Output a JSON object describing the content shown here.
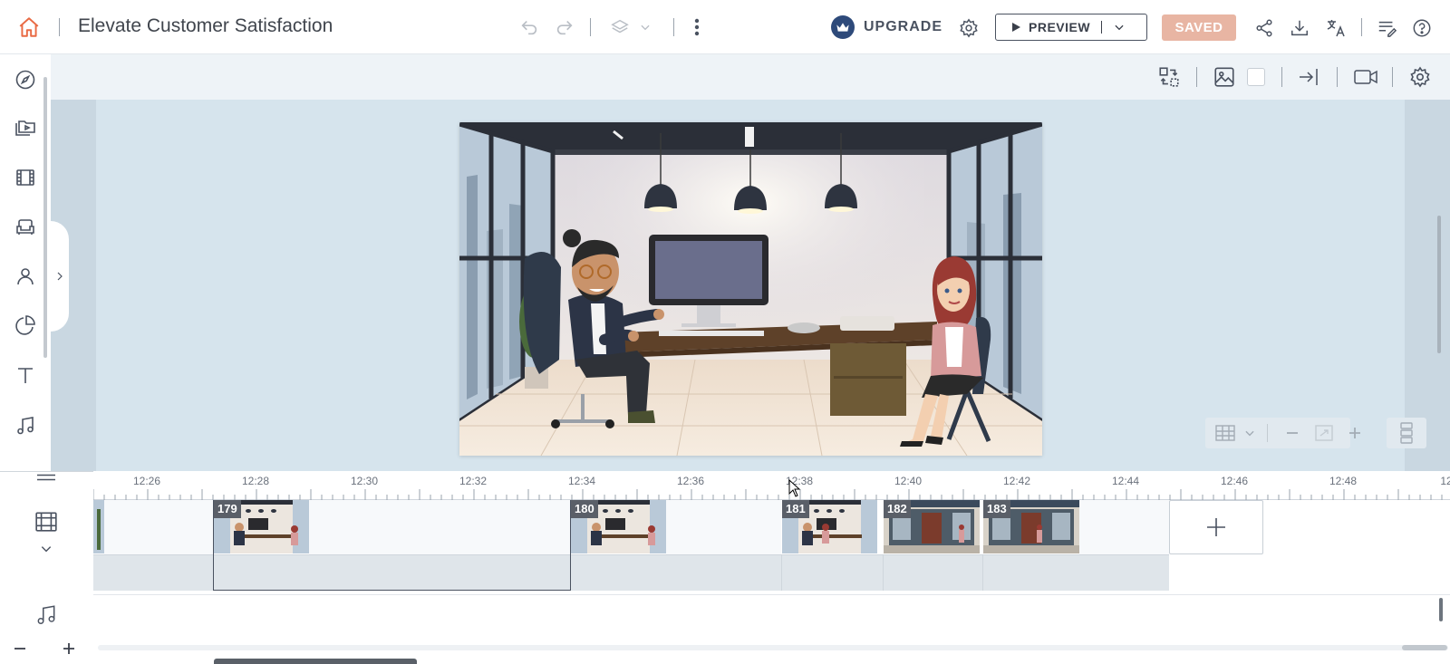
{
  "header": {
    "title": "Elevate Customer Satisfaction",
    "upgrade_label": "UPGRADE",
    "preview_label": "PREVIEW",
    "saved_label": "SAVED"
  },
  "sidebar": {
    "items": [
      {
        "name": "explore",
        "icon": "compass-icon"
      },
      {
        "name": "media",
        "icon": "video-folder-icon"
      },
      {
        "name": "scenes",
        "icon": "film-icon"
      },
      {
        "name": "props",
        "icon": "armchair-icon"
      },
      {
        "name": "characters",
        "icon": "person-icon"
      },
      {
        "name": "charts",
        "icon": "pie-chart-icon"
      },
      {
        "name": "text",
        "icon": "text-icon"
      },
      {
        "name": "audio",
        "icon": "music-icon"
      }
    ]
  },
  "timeline": {
    "ticks": [
      "12:26",
      "12:28",
      "12:30",
      "12:32",
      "12:34",
      "12:36",
      "12:38",
      "12:40",
      "12:42",
      "12:44",
      "12:46",
      "12:48",
      "12"
    ],
    "scenes": [
      {
        "number": "179",
        "thumb": "office"
      },
      {
        "number": "180",
        "thumb": "office"
      },
      {
        "number": "181",
        "thumb": "office"
      },
      {
        "number": "182",
        "thumb": "storefront"
      },
      {
        "number": "183",
        "thumb": "storefront"
      }
    ]
  },
  "colors": {
    "accent": "#e96a44",
    "saved_bg": "#e8b5a3",
    "workspace_bg": "#d6e4ed"
  }
}
